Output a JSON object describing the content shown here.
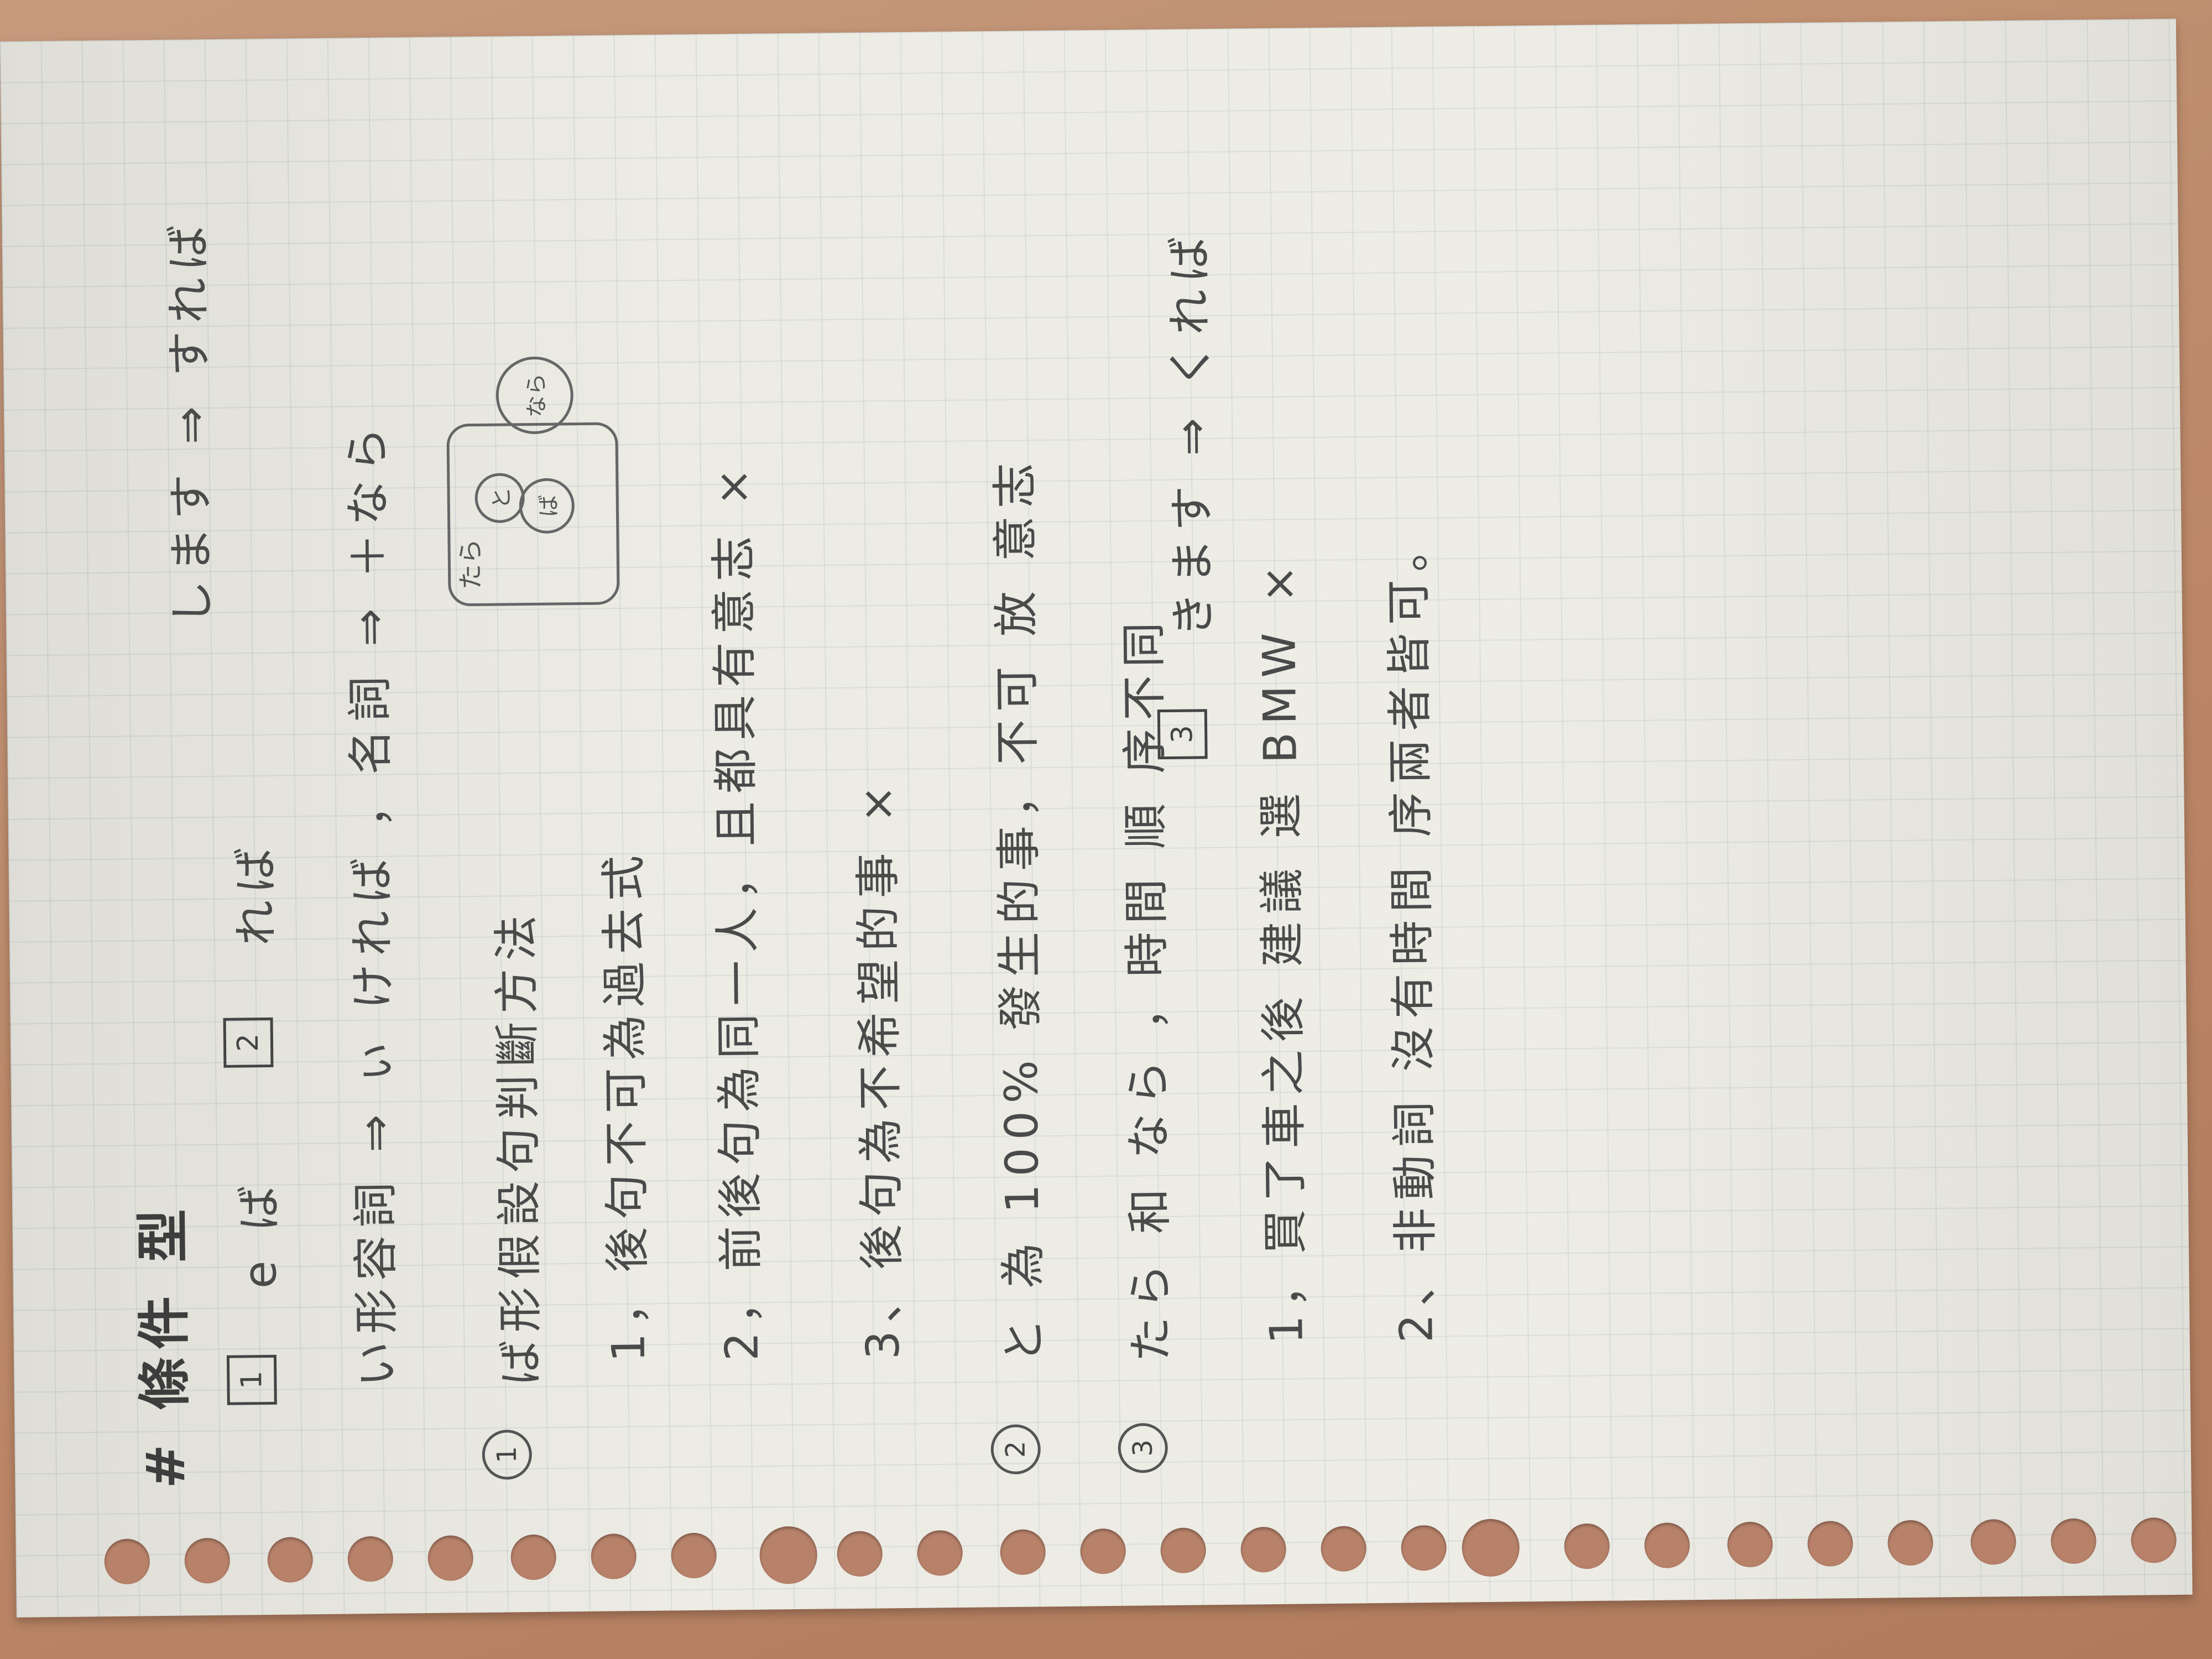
{
  "notes": {
    "title": "# 條件 型",
    "row_forms": {
      "left": "e ば",
      "middle": "れば",
      "right_top": "します ⇒ すれば",
      "right_bottom": "きます ⇒ くれば"
    },
    "row_adj": "い形容詞 ⇒ ぃ ければ ，名詞 ⇒ ＋なら",
    "section1_title": "ば形假設句判斷方法",
    "section1_items": [
      "1，後句不可為過去式",
      "2，前後句為同一人，且都具有意志 ×",
      "3、後句為不希望的事 ×"
    ],
    "section2": "と 為 100% 發生的事，不可 放 意志",
    "section3": "たら 和 なら ，時間 順 序不同",
    "section3_items": [
      "1，買了車之後 建議 選 BMW ×",
      "2、非動詞 沒有時間 序兩者皆可。"
    ],
    "diagram": {
      "outer_label": "たら",
      "inner_labels": [
        "と",
        "ば",
        "なら"
      ]
    },
    "section_markers": [
      "1",
      "2",
      "3"
    ],
    "box_markers": [
      "1",
      "2",
      "3"
    ]
  }
}
